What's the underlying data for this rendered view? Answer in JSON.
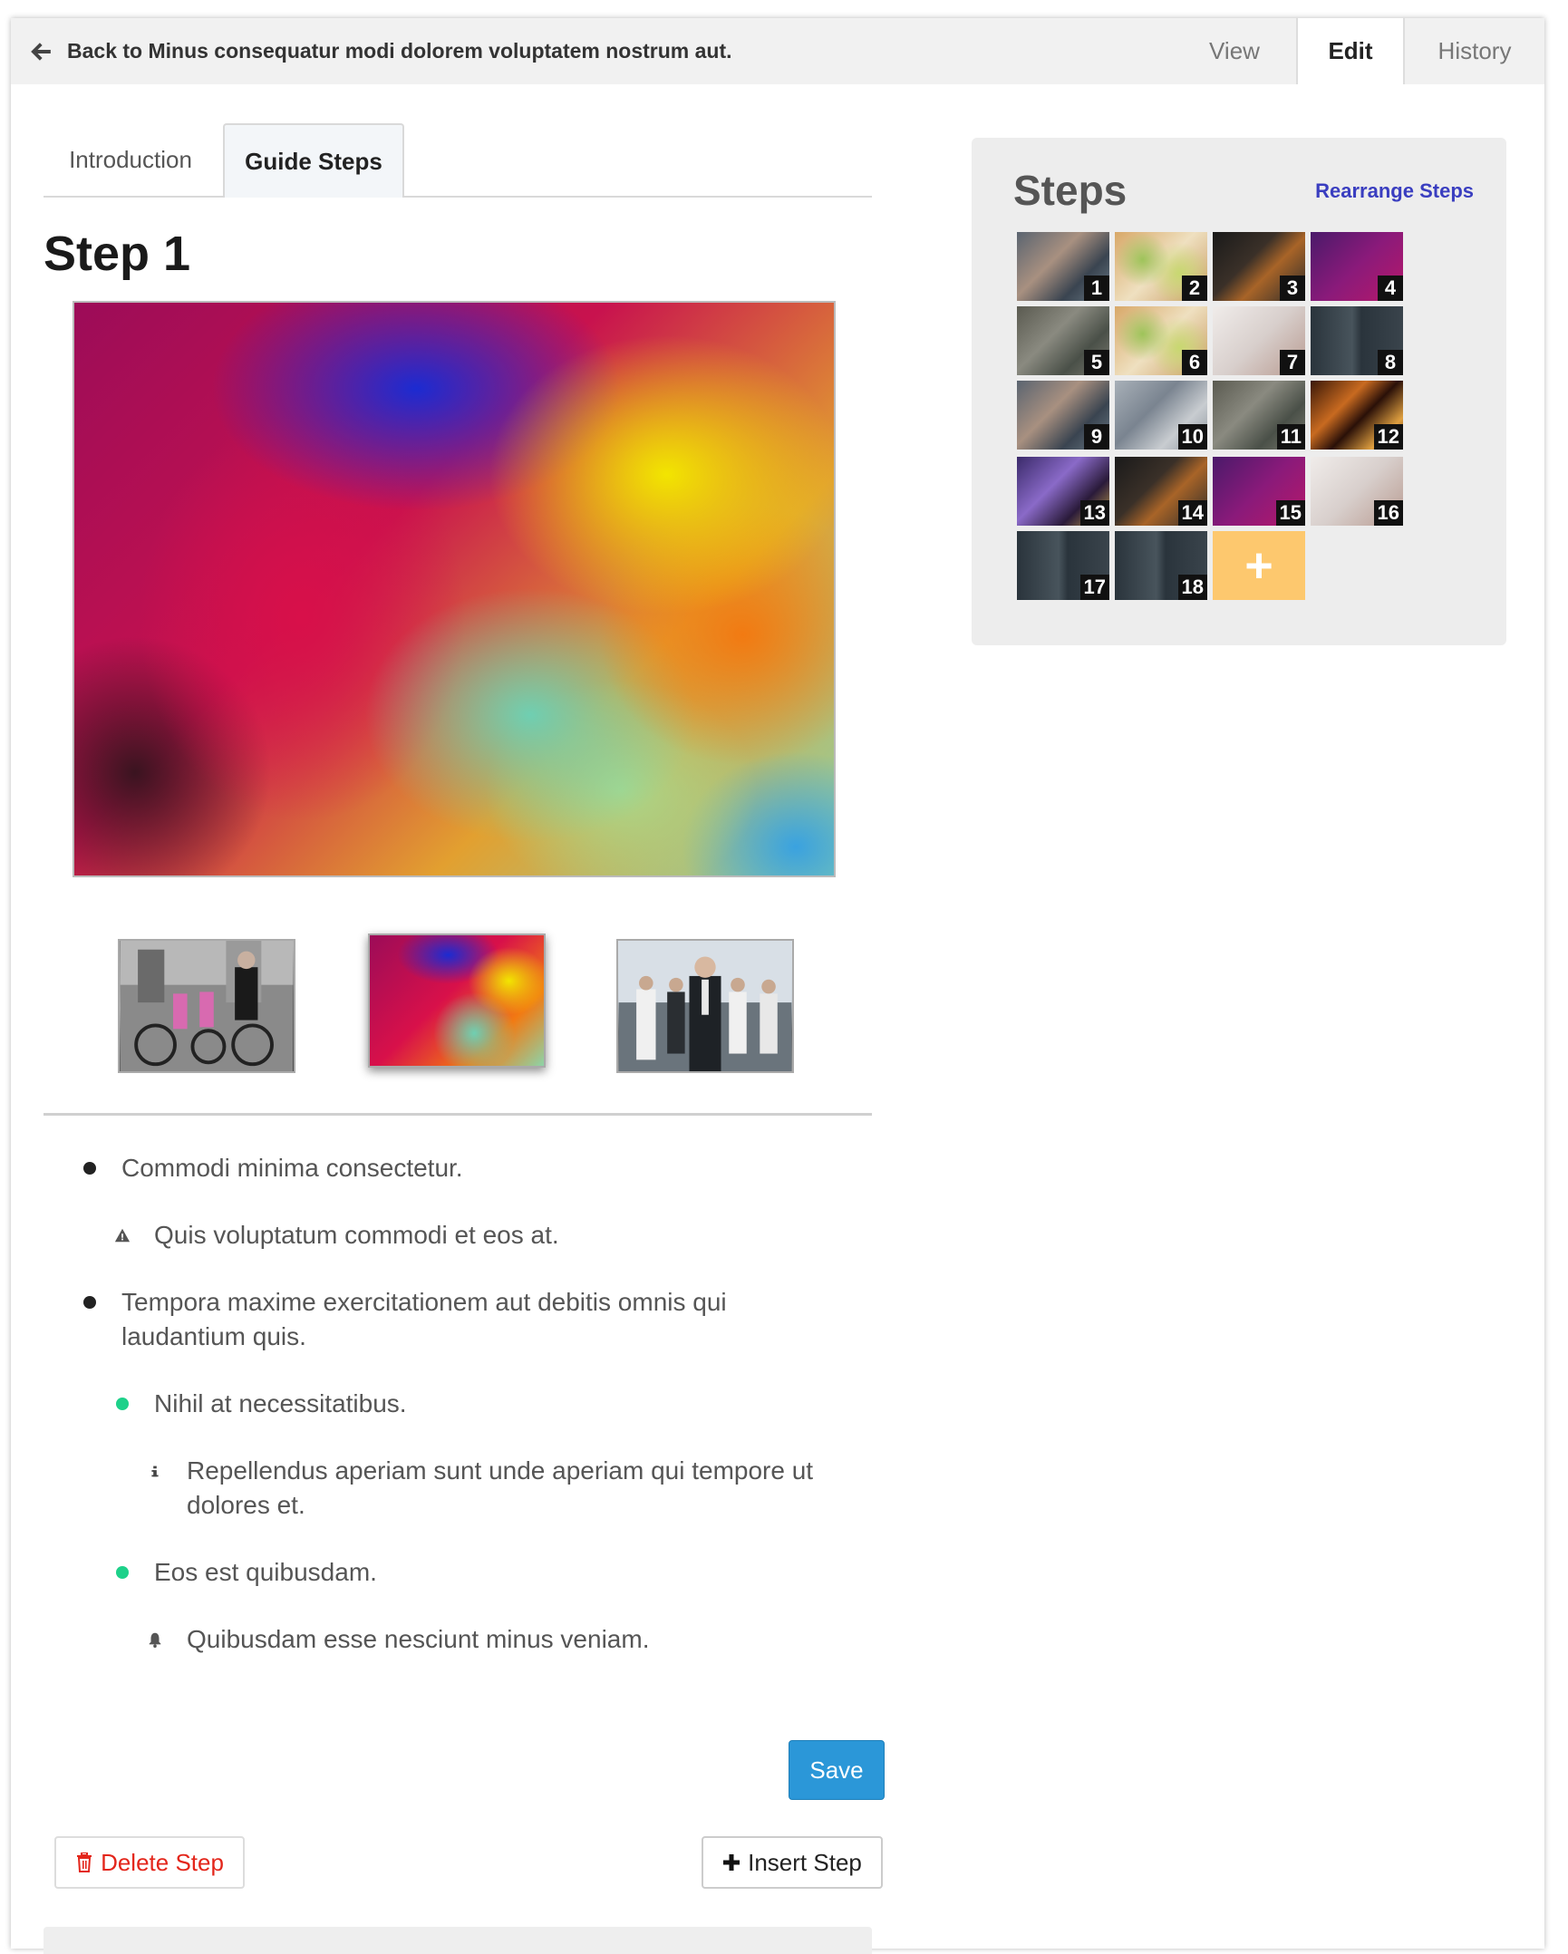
{
  "topbar": {
    "back_label": "Back to Minus consequatur modi dolorem voluptatem nostrum aut.",
    "nav": {
      "view": "View",
      "edit": "Edit",
      "history": "History"
    }
  },
  "tabs": {
    "introduction": "Introduction",
    "guide_steps": "Guide Steps",
    "active": "Guide Steps"
  },
  "step": {
    "title": "Step 1"
  },
  "bullets": [
    {
      "text": "Commodi minima consectetur.",
      "level": 0,
      "marker": "black-dot"
    },
    {
      "text": "Quis voluptatum commodi et eos at.",
      "level": 1,
      "marker": "warning-icon"
    },
    {
      "text": "Tempora maxime exercitationem aut debitis omnis qui laudantium quis.",
      "level": 0,
      "marker": "black-dot"
    },
    {
      "text": "Nihil at necessitatibus.",
      "level": 1,
      "marker": "green-dot"
    },
    {
      "text": "Repellendus aperiam sunt unde aperiam qui tempore ut dolores et.",
      "level": 2,
      "marker": "info-icon"
    },
    {
      "text": "Eos est quibusdam.",
      "level": 1,
      "marker": "green-dot"
    },
    {
      "text": "Quibusdam esse nesciunt minus veniam.",
      "level": 2,
      "marker": "bell-icon"
    }
  ],
  "buttons": {
    "save": "Save",
    "delete_step": "Delete Step",
    "insert_step": "Insert Step"
  },
  "steps_panel": {
    "title": "Steps",
    "rearrange_label": "Rearrange Steps",
    "steps": [
      "1",
      "2",
      "3",
      "4",
      "5",
      "6",
      "7",
      "8",
      "9",
      "10",
      "11",
      "12",
      "13",
      "14",
      "15",
      "16",
      "17",
      "18"
    ],
    "add_label": "+"
  },
  "colors": {
    "accent": "#2b97d8",
    "danger": "#e3261b",
    "link": "#3a3ec0",
    "add_step": "#fdc86e",
    "bullet_green": "#1ed18a"
  }
}
